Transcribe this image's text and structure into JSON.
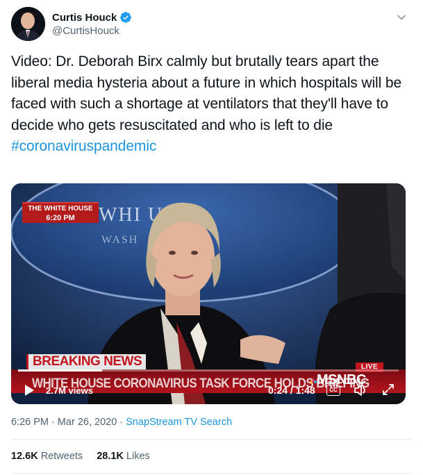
{
  "author": {
    "display_name": "Curtis Houck",
    "handle": "@CurtisHouck",
    "verified": true,
    "avatar_icon": "profile-photo"
  },
  "tweet": {
    "text": "Video: Dr. Deborah Birx calmly but brutally tears apart the liberal media hysteria about a future in which hospitals will be faced with such a shortage at ventilators that they'll have to decide who gets resuscitated and who is left to die",
    "hashtag": "#coronaviruspandemic"
  },
  "video": {
    "network_bug_line1": "THE WHITE HOUSE",
    "network_bug_time": "6:20 PM",
    "breaking_label": "BREAKING NEWS",
    "live_label": "LIVE",
    "chyron": "WHITE HOUSE CORONAVIRUS TASK FORCE HOLDS BRIEFING",
    "network_logo": "MSNBC",
    "views": "2.7M views",
    "timecode": "0:24 / 1:48",
    "progress": 0.22,
    "cc_label": "CC",
    "backdrop_text_top": "WHI   USE",
    "backdrop_text_bottom": "WASH"
  },
  "meta": {
    "time": "6:26 PM",
    "separator": "·",
    "date": "Mar 26, 2020",
    "source": "SnapStream TV Search"
  },
  "stats": {
    "retweets_count": "12.6K",
    "retweets_label": "Retweets",
    "likes_count": "28.1K",
    "likes_label": "Likes"
  },
  "colors": {
    "link": "#1b95e0",
    "verified": "#1d9bf0",
    "breaking_red": "#c2151f"
  }
}
